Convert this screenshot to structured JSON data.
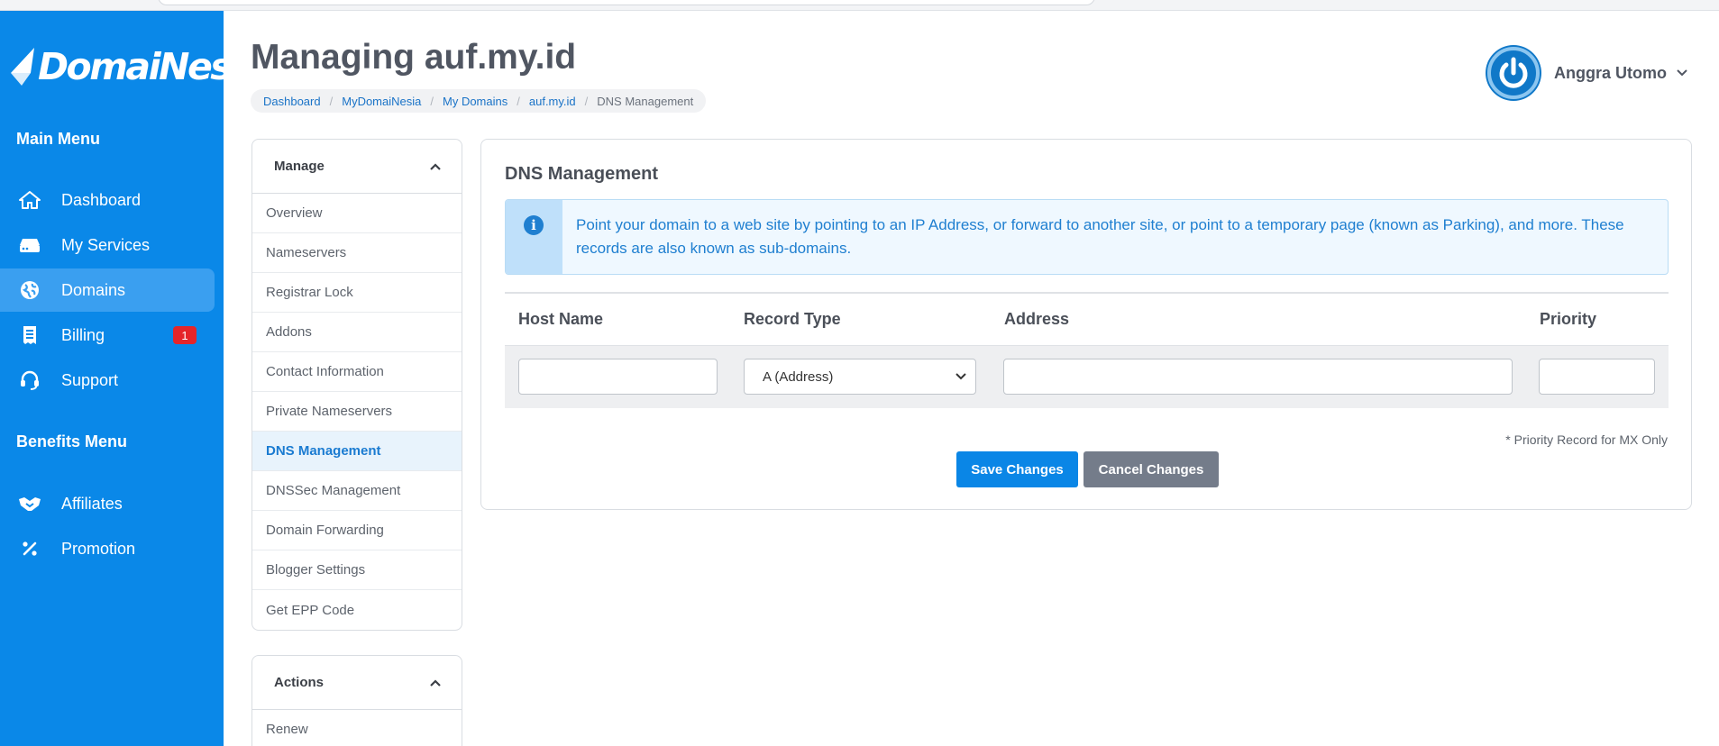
{
  "brand": {
    "name": "DomaiNesia",
    "accent": "#0a88e8"
  },
  "sidebar": {
    "main_menu_title": "Main Menu",
    "main_items": [
      {
        "label": "Dashboard",
        "icon": "home-icon"
      },
      {
        "label": "My Services",
        "icon": "server-icon"
      },
      {
        "label": "Domains",
        "icon": "globe-icon",
        "active": true
      },
      {
        "label": "Billing",
        "icon": "receipt-icon",
        "badge": "1"
      },
      {
        "label": "Support",
        "icon": "headset-icon"
      }
    ],
    "benefits_title": "Benefits Menu",
    "benefit_items": [
      {
        "label": "Affiliates",
        "icon": "handshake-icon"
      },
      {
        "label": "Promotion",
        "icon": "percent-icon"
      }
    ]
  },
  "header": {
    "title": "Managing auf.my.id",
    "breadcrumb": [
      "Dashboard",
      "MyDomaiNesia",
      "My Domains",
      "auf.my.id",
      "DNS Management"
    ],
    "user_name": "Anggra Utomo"
  },
  "manage_panel": {
    "title": "Manage",
    "items": [
      "Overview",
      "Nameservers",
      "Registrar Lock",
      "Addons",
      "Contact Information",
      "Private Nameservers",
      "DNS Management",
      "DNSSec Management",
      "Domain Forwarding",
      "Blogger Settings",
      "Get EPP Code"
    ],
    "active": "DNS Management"
  },
  "actions_panel": {
    "title": "Actions",
    "items": [
      "Renew"
    ]
  },
  "dns": {
    "title": "DNS Management",
    "info_text": "Point your domain to a web site by pointing to an IP Address, or forward to another site, or point to a temporary page (known as Parking), and more. These records are also known as sub-domains.",
    "columns": [
      "Host Name",
      "Record Type",
      "Address",
      "Priority"
    ],
    "row": {
      "host": "",
      "record_type": "A (Address)",
      "address": "",
      "priority": ""
    },
    "note": "* Priority Record for MX Only",
    "save_label": "Save Changes",
    "cancel_label": "Cancel Changes"
  }
}
